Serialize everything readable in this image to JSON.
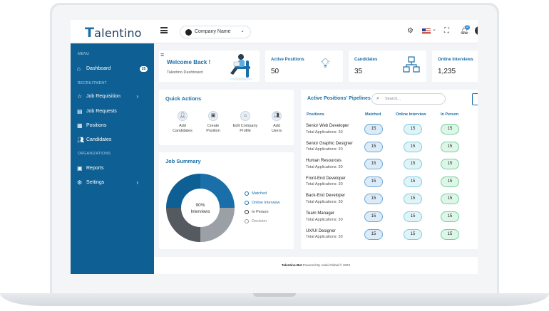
{
  "header": {
    "logo": "alentino",
    "logo_mark": "T",
    "company": "Company Name",
    "notification_count": "3"
  },
  "sidebar": {
    "section_menu": "MENU",
    "section_recruitment": "RECRUITMENT",
    "section_organizations": "ORGANIZATIONS",
    "items": [
      {
        "label": "Dashboard",
        "count": "25"
      },
      {
        "label": "Job Requisition"
      },
      {
        "label": "Job Requests"
      },
      {
        "label": "Positions"
      },
      {
        "label": "Candidates"
      },
      {
        "label": "Reports"
      },
      {
        "label": "Settings"
      }
    ]
  },
  "welcome": {
    "title": "Welcome Back !",
    "subtitle": "Talentino Dashboard"
  },
  "stats": [
    {
      "label": "Active Positions",
      "value": "50"
    },
    {
      "label": "Candidates",
      "value": "35"
    },
    {
      "label": "Online Interviews",
      "value": "1,235"
    }
  ],
  "quick_actions": {
    "title": "Quick Actions",
    "items": [
      {
        "line1": "Add",
        "line2": "Candidates"
      },
      {
        "line1": "Create",
        "line2": "Position"
      },
      {
        "line1": "Edit Company",
        "line2": "Profile"
      },
      {
        "line1": "Add",
        "line2": "Users"
      }
    ]
  },
  "job_summary": {
    "title": "Job Summary",
    "center_value": "90%",
    "center_label": "Interviews",
    "legend": [
      "Matched",
      "Online Interview",
      "In Person",
      "Decision"
    ],
    "colors": [
      "#1b6fa8",
      "#7fa9c9",
      "#555a60",
      "#9aa0a6"
    ]
  },
  "pipelines": {
    "title": "Active Positions' Pipelines",
    "search_placeholder": "Search...",
    "columns": [
      "Positions",
      "Matched",
      "Online Interview",
      "In Person"
    ],
    "rows": [
      {
        "title": "Senior Web Developer",
        "apps": "Total Applications: 30",
        "matched": "15",
        "online": "15",
        "inperson": "15"
      },
      {
        "title": "Senior Graphic Designer",
        "apps": "Total Applications: 30",
        "matched": "15",
        "online": "15",
        "inperson": "15"
      },
      {
        "title": "Human Resources",
        "apps": "Total Applications: 30",
        "matched": "15",
        "online": "15",
        "inperson": "15"
      },
      {
        "title": "Front-End Developer",
        "apps": "Total Applications: 30",
        "matched": "15",
        "online": "15",
        "inperson": "15"
      },
      {
        "title": "Back-End Developer",
        "apps": "Total Applications: 30",
        "matched": "15",
        "online": "15",
        "inperson": "15"
      },
      {
        "title": "Team Manager",
        "apps": "Total Applications: 30",
        "matched": "15",
        "online": "15",
        "inperson": "15"
      },
      {
        "title": "UX/UI Designer",
        "apps": "Total Applications: 30",
        "matched": "15",
        "online": "15",
        "inperson": "15"
      }
    ]
  },
  "footer": {
    "brand": "Talentino-Bot",
    "text": "Powered By Arabi-Global © 2023"
  }
}
